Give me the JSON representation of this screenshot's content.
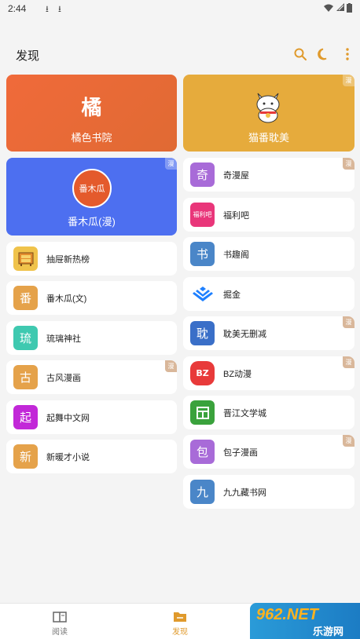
{
  "status_bar": {
    "time": "2:44"
  },
  "header": {
    "title": "发现"
  },
  "featured": [
    {
      "label": "橘色书院",
      "logo_text": "橘",
      "color": "#ea6b37"
    },
    {
      "label": "猫番耽美",
      "color": "#e6ab3c",
      "tag": "漫"
    },
    {
      "label": "番木瓜(漫)",
      "logo_text": "番木瓜",
      "color": "#4d6ff0",
      "tag": "漫"
    }
  ],
  "left_items": [
    {
      "label": "抽屉新热榜",
      "icon": "drawer-icon",
      "color": "#f0c34b"
    },
    {
      "label": "番木瓜(文)",
      "glyph": "番",
      "color": "#e5a24a"
    },
    {
      "label": "琉璃神社",
      "glyph": "琉",
      "color": "#3fc9b0"
    },
    {
      "label": "古风漫画",
      "glyph": "古",
      "color": "#e5a24a",
      "tag": "漫"
    },
    {
      "label": "起舞中文网",
      "glyph": "起",
      "color": "#c228d8"
    },
    {
      "label": "新暖才小说",
      "glyph": "新",
      "color": "#e5a24a"
    }
  ],
  "right_items": [
    {
      "label": "奇漫屋",
      "glyph": "奇",
      "color": "#a86bd8",
      "tag": "漫"
    },
    {
      "label": "福利吧",
      "logo_text": "福利吧",
      "color": "#e9367a"
    },
    {
      "label": "书趣阁",
      "glyph": "书",
      "color": "#4a86c8"
    },
    {
      "label": "掘金",
      "icon": "juejin-icon",
      "color": "#1e80ff"
    },
    {
      "label": "耽美无删减",
      "glyph": "耽",
      "color": "#3a6fc8",
      "tag": "漫"
    },
    {
      "label": "BZ动漫",
      "logo_text": "BZ",
      "color": "#e83a3a",
      "tag": "漫"
    },
    {
      "label": "晋江文学城",
      "icon": "jinjiang-icon",
      "color": "#3aa23c"
    },
    {
      "label": "包子漫画",
      "glyph": "包",
      "color": "#a86bd8",
      "tag": "漫"
    },
    {
      "label": "九九藏书网",
      "glyph": "九",
      "color": "#4a86c8"
    }
  ],
  "bottom_nav": {
    "read": "阅读",
    "discover": "发现",
    "active_color": "#e09a2c"
  },
  "watermark": {
    "brand": "962.NET",
    "site": "乐游网"
  }
}
